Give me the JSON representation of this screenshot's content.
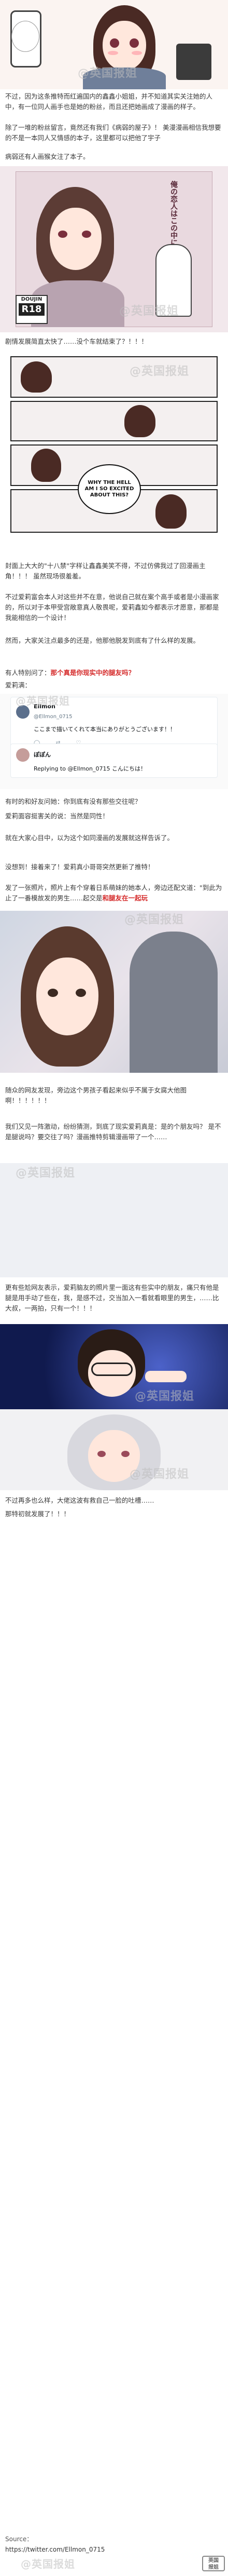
{
  "watermark": "@英国报姐",
  "paragraphs": {
    "p1": "不过，因为这条推特而红遍国内的鑫鑫小姐姐，并不知道其实关注她的人中，有一位同人画手也是她的粉丝，而且还把她画成了漫画的样子。",
    "p2": "除了一堆的粉丝留言，竟然还有我们《病弱的屋子》！ 美漫漫画相信我想要的不是一本同人又情感的本子，这里都可以把他了宇子",
    "p3": "病弱还有人画猴女注了本子。",
    "p4": "剧情发展简直太快了……没个车就结束了？！！！",
    "p5": "封面上大大的\"十八禁\"字样让鑫鑫美笑不得，不过仿佛我过了回漫画主角！！！ 虽然现场很羞羞。",
    "p6": "不过爱莉富会本人对这些并不在意，他说自己就在案个高手或者是小漫画家的，所以对于本甲受宫敞意真人敬畏呢，爱莉鑫如今都表示才愿意，那都是我能相信的一个设计！",
    "p7": "然而，大家关注点最多的还是，他那他脱发到底有了什么样的发展。",
    "p8_prefix": "有人特别问了：",
    "p8_red": "那个真是你现实中的腿友吗？",
    "p9": "爱莉满：",
    "p10": "有时的和好友问她：你到底有没有那些交往呢？",
    "p11": "爱莉面容挺害关的说：当然是同性！",
    "p12": "就在大家心目中，以为这个如同漫画的发展就这样告诉了。",
    "p13": "没想到！接着来了！爱莉真小哥哥突然更新了推特！",
    "p14_prefix": "发了一张照片，照片上有个穿着日系萌妹的她本人，旁边还配文道：\"到此为止了一番模故发的男生……起交是",
    "p14_red": "和腿友在一起玩",
    "p15": "随众的网友发现，旁边这个男孩子看起来似乎不属于女腐大他图啊！！！！！！",
    "p16": "我们又见一阵激动，纷纷猜测，到底了现实爱莉真是：是的个朋友吗？ 是不是腿说吗？要交往了吗？漫画推特剪辑漫画带了一个……",
    "p17": "更有些尬网友表示，爱莉脑友的照片里一面这有些实中的朋友，痛只有他是腿是用手动了些在，我，是感不过，交当加入一看就看眼里的男生，……比大叔，一两拍，只有一个！！！",
    "p18": "不过再多也么样，大佬这波有救自己一脸的吐槽……",
    "p19": "那特初就发展了！！！"
  },
  "manga": {
    "cover_title": "俺の恋人はこの中に1人",
    "cover_badge_top": "DOUJIN",
    "cover_badge_mid": "R18",
    "speech_1": "WHY THE HELL AM I SO EXCITED ABOUT THIS?",
    "speech_2": "..."
  },
  "tweet": {
    "name": "Ellmon",
    "handle": "@Ellmon_0715",
    "text": "ここまで描いてくれて本当にありがとうございます！！",
    "reply_name": "ぽぽん",
    "reply_text": "Replying to @Ellmon_0715 こんにちは！"
  },
  "source": {
    "label": "Source：",
    "url": "https://twitter.com/Ellmon_0715"
  },
  "logo": {
    "line1": "英国",
    "line2": "报姐"
  }
}
